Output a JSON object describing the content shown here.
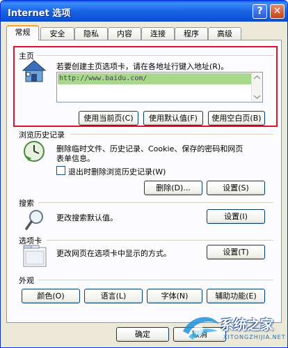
{
  "window": {
    "title": "Internet 选项",
    "help_glyph": "?",
    "close_glyph": "✕"
  },
  "tabs": [
    "常规",
    "安全",
    "隐私",
    "内容",
    "连接",
    "程序",
    "高级"
  ],
  "home": {
    "section": "主页",
    "desc": "若要创建主页选项卡，请在各地址行键入地址(R)。",
    "url": "http://www.baidu.com/",
    "buttons": [
      "使用当前页(C)",
      "使用默认值(F)",
      "使用空白页(B)"
    ]
  },
  "history": {
    "section": "浏览历史记录",
    "desc1": "删除临时文件、历史记录、Cookie、保存的密码和网页",
    "desc2": "表单信息。",
    "checkbox_label": "退出时删除浏览历史记录(W)",
    "delete_button": "删除(D)...",
    "settings_button": "设置(S)"
  },
  "search": {
    "section": "搜索",
    "desc": "更改搜索默认值。",
    "settings_button": "设置(I)"
  },
  "tabsec": {
    "section": "选项卡",
    "desc": "更改网页在选项卡中显示的方式。",
    "settings_button": "设置(T)"
  },
  "appearance": {
    "section": "外观",
    "buttons": [
      "颜色(O)",
      "语言(L)",
      "字体(N)",
      "辅助功能(E)"
    ]
  },
  "footer": {
    "ok": "确定",
    "cancel": "取消"
  },
  "watermark": {
    "text": "系统之家",
    "url": "XITONGZHIJIA.NET"
  },
  "colors": {
    "titlebar": "#0a5ce8",
    "highlight_border": "#e0102a",
    "url_selection": "#a8d88c"
  }
}
